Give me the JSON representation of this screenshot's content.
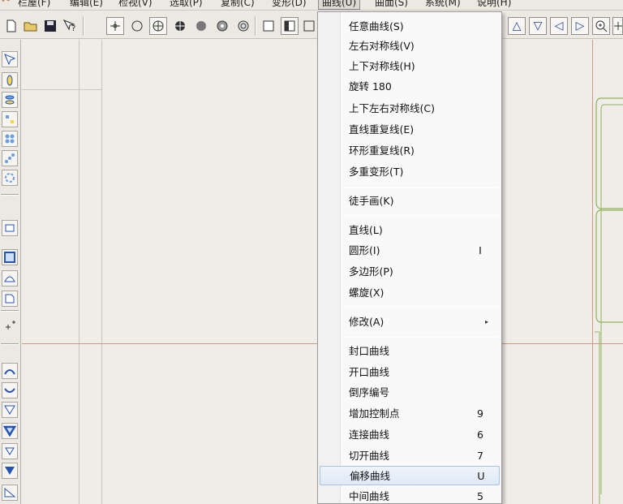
{
  "menubar": {
    "items": [
      {
        "label": "栏屋(F)"
      },
      {
        "label": "编辑(E)"
      },
      {
        "label": "检视(V)"
      },
      {
        "label": "选取(P)"
      },
      {
        "label": "复制(C)"
      },
      {
        "label": "变形(D)"
      },
      {
        "label": "曲线(U)"
      },
      {
        "label": "曲面(S)"
      },
      {
        "label": "系统(M)"
      },
      {
        "label": "说明(H)"
      }
    ]
  },
  "toolbar": {
    "icons": [
      "new-file-icon",
      "open-file-icon",
      "save-icon",
      "help-cursor-icon",
      "point-snap-icon",
      "circle-icon",
      "circle-cross-icon",
      "filled-circle-cross-icon",
      "gray-dot-icon",
      "gear-dot-icon",
      "ring-dot-icon",
      "square-icon",
      "split-square-icon",
      "square-outline-icon",
      "triangle-up-icon",
      "triangle-down-icon",
      "triangle-left-icon",
      "triangle-right-icon",
      "zoom-in-icon",
      "plus-box-icon"
    ]
  },
  "dropdown": {
    "items": [
      {
        "label": "任意曲线(S)",
        "shortcut": ""
      },
      {
        "label": "左右对称线(V)",
        "shortcut": ""
      },
      {
        "label": "上下对称线(H)",
        "shortcut": ""
      },
      {
        "label": "旋转 180",
        "shortcut": ""
      },
      {
        "label": "上下左右对称线(C)",
        "shortcut": ""
      },
      {
        "label": "直线重复线(E)",
        "shortcut": ""
      },
      {
        "label": "环形重复线(R)",
        "shortcut": ""
      },
      {
        "label": "多重变形(T)",
        "shortcut": ""
      },
      {
        "label": "徒手画(K)",
        "shortcut": ""
      },
      {
        "label": "直线(L)",
        "shortcut": ""
      },
      {
        "label": "圆形(I)",
        "shortcut": "I"
      },
      {
        "label": "多边形(P)",
        "shortcut": ""
      },
      {
        "label": "螺旋(X)",
        "shortcut": ""
      },
      {
        "label": "修改(A)",
        "shortcut": ""
      },
      {
        "label": "封口曲线",
        "shortcut": ""
      },
      {
        "label": "开口曲线",
        "shortcut": ""
      },
      {
        "label": "倒序编号",
        "shortcut": ""
      },
      {
        "label": "增加控制点",
        "shortcut": "9"
      },
      {
        "label": "连接曲线",
        "shortcut": "6"
      },
      {
        "label": "切开曲线",
        "shortcut": "7"
      },
      {
        "label": "偏移曲线",
        "shortcut": "U"
      },
      {
        "label": "中间曲线",
        "shortcut": "5"
      }
    ],
    "submenu_arrow": "▸"
  },
  "colors": {
    "highlight": "#dfe9f6",
    "guide_red": "#c99a85",
    "shape_green": "#8fb35a"
  }
}
